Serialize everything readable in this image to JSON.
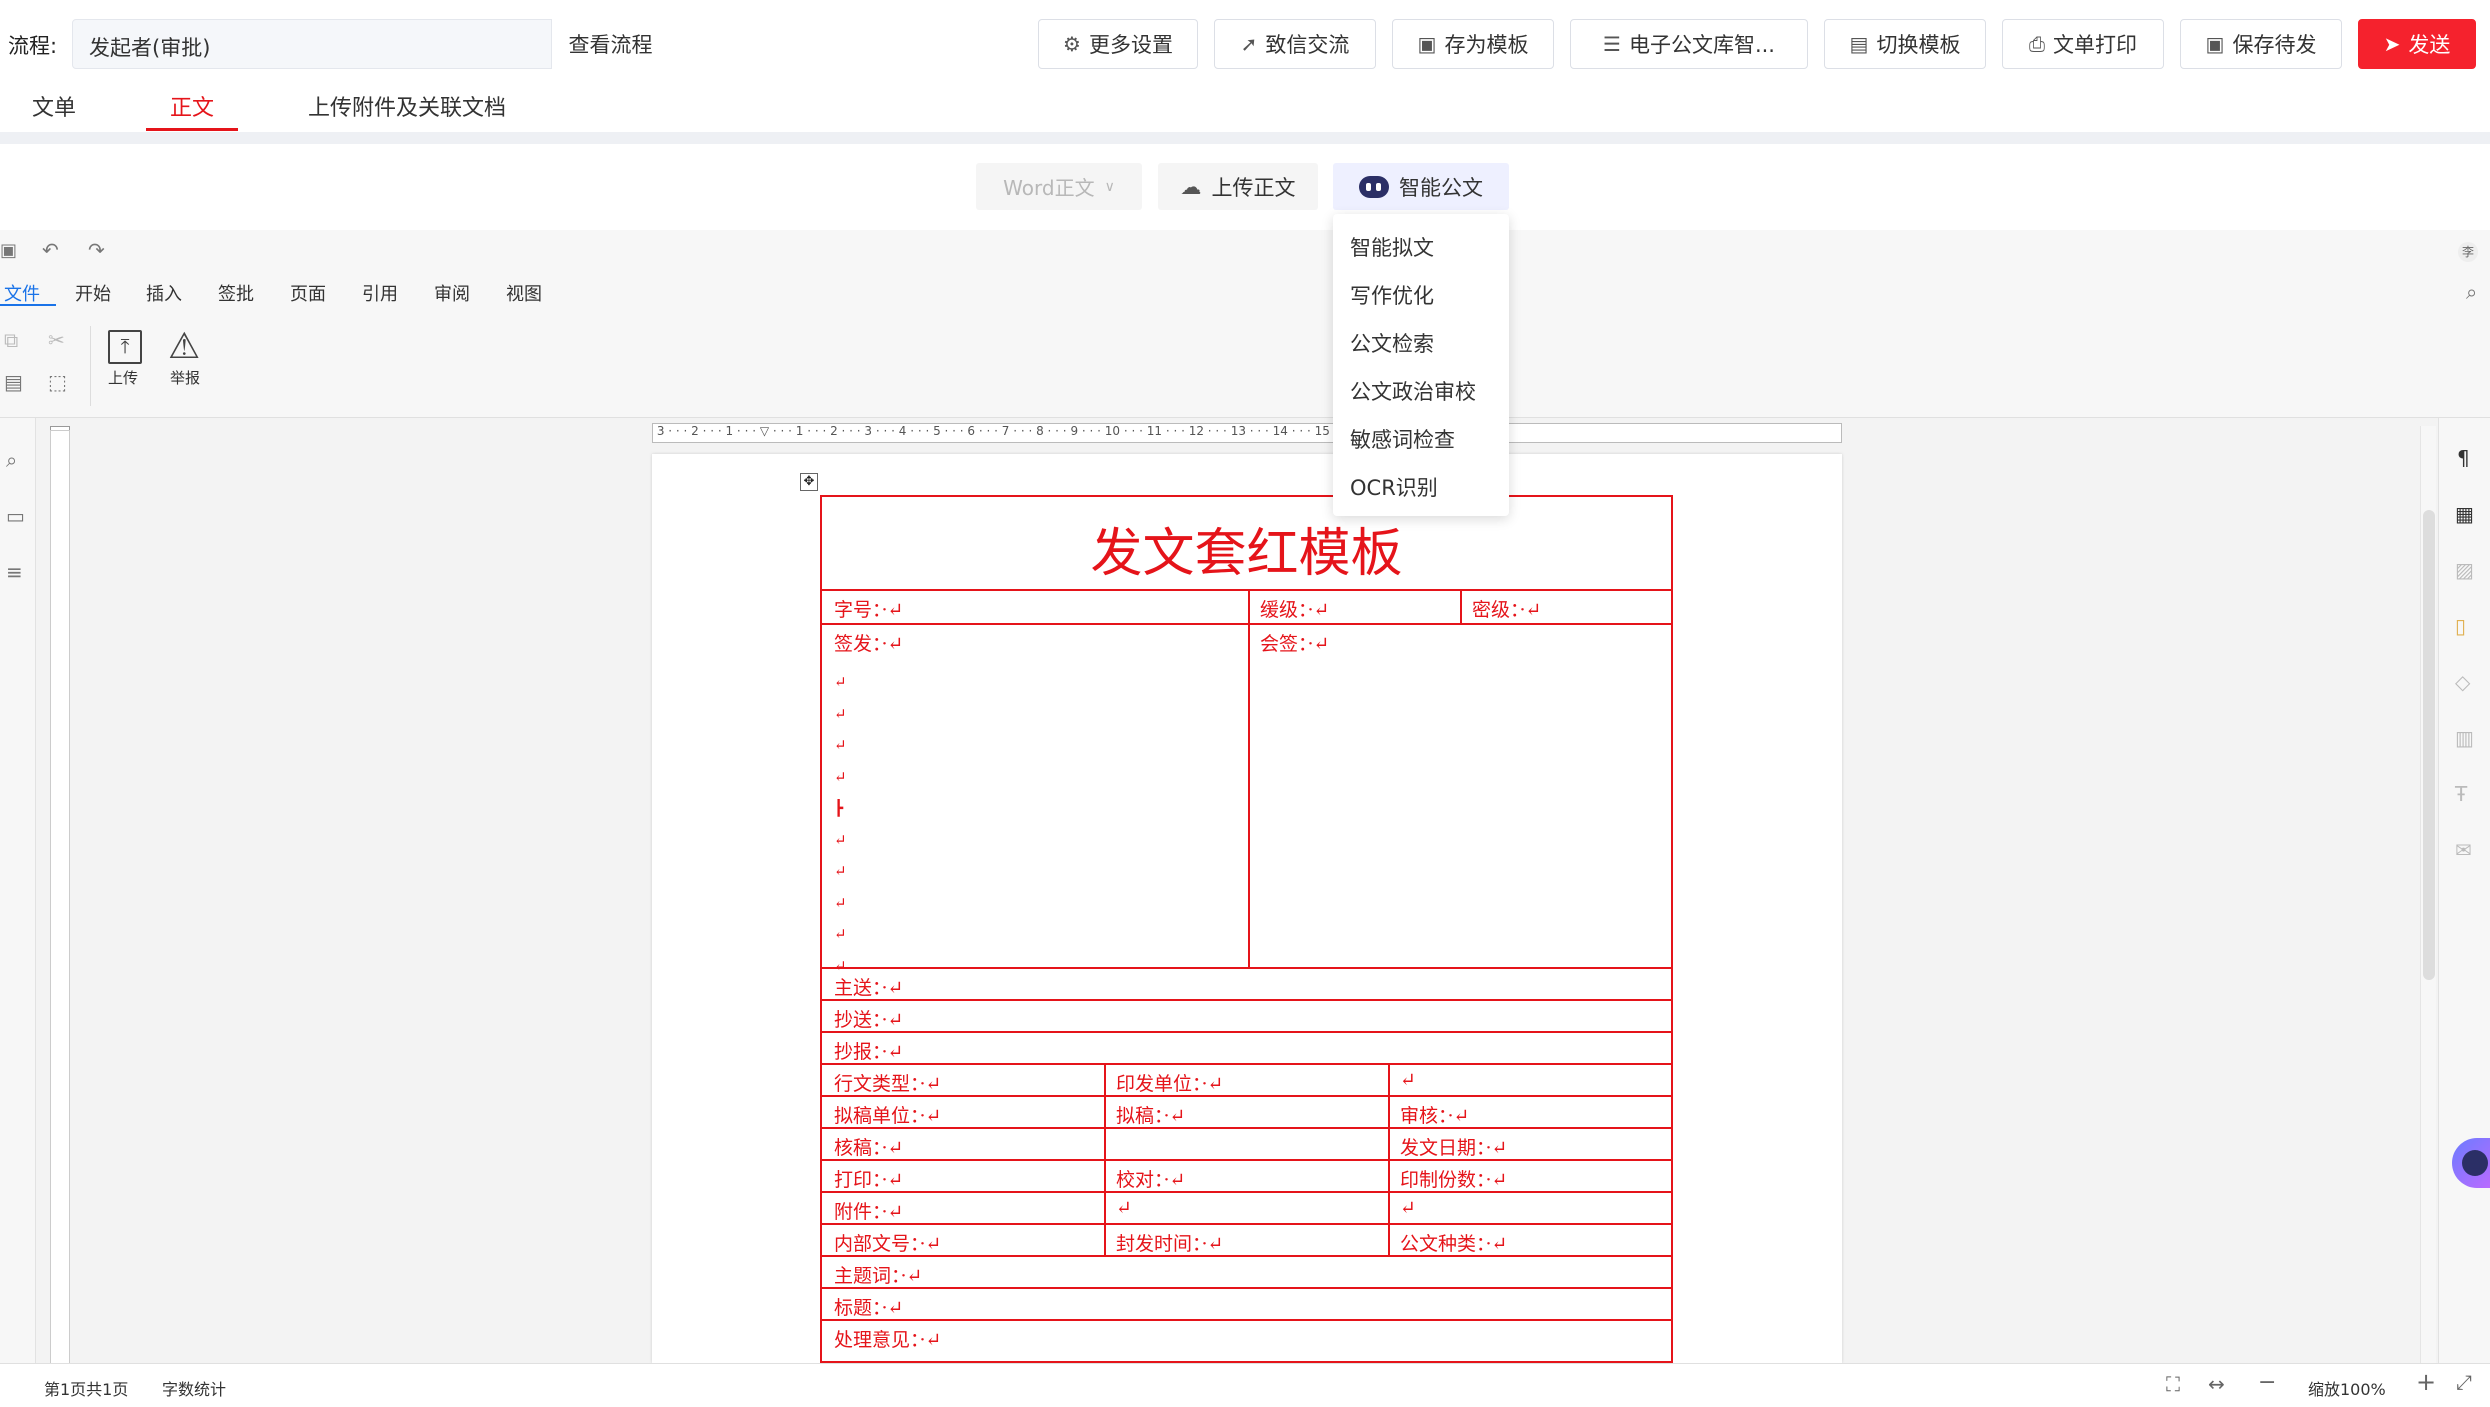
{
  "header": {
    "flow_label": "流程:",
    "flow_value": "发起者(审批)",
    "view_flow": "查看流程",
    "buttons": [
      "更多设置",
      "致信交流",
      "存为模板",
      "电子公文库智...",
      "切换模板",
      "文单打印",
      "保存待发"
    ],
    "send": "发送"
  },
  "tabs": [
    "文单",
    "正文",
    "上传附件及关联文档"
  ],
  "toolbar": {
    "word": "Word正文",
    "upload": "上传正文",
    "smart": "智能公文"
  },
  "dropdown": [
    "智能拟文",
    "写作优化",
    "公文检索",
    "公文政治审校",
    "敏感词检查",
    "OCR识别"
  ],
  "editor": {
    "menus": [
      "文件",
      "开始",
      "插入",
      "签批",
      "页面",
      "引用",
      "审阅",
      "视图"
    ],
    "ribbon": {
      "upload": "上传",
      "report": "举报"
    },
    "user_initial": "李"
  },
  "doc": {
    "title": "发文套红模板",
    "cells": {
      "zihao": "字号：",
      "huanji": "缓级：",
      "miji": "密级：",
      "qianfa": "签发：",
      "huiqian": "会签：",
      "zhusong": "主送：",
      "chaosong": "抄送：",
      "chaobao": "抄报：",
      "xingwen": "行文类型：",
      "yinfa": "印发单位：",
      "nigao_danwei": "拟稿单位：",
      "nigao": "拟稿：",
      "shenhe": "审核：",
      "hegao": "核稿：",
      "fawen_riqi": "发文日期：",
      "dayin": "打印：",
      "jiaodui": "校对：",
      "yinzhi": "印制份数：",
      "fujian": "附件：",
      "neibu": "内部文号：",
      "fengfa": "封发时间：",
      "zhonglei": "公文种类：",
      "zhuti": "主题词：",
      "biaoti": "标题：",
      "chuli": "处理意见："
    }
  },
  "status": {
    "page": "第1页共1页",
    "wordcount": "字数统计",
    "zoom": "缩放100%"
  },
  "colors": {
    "accent": "#e5141a",
    "send": "#f5222d"
  }
}
